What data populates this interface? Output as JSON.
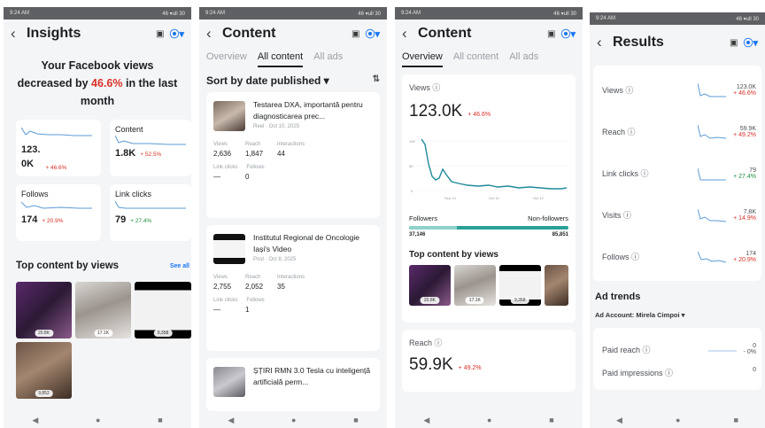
{
  "status": {
    "time": "9:24 AM",
    "icons": "46 ▾ull 30"
  },
  "phone1": {
    "title": "Insights",
    "headline_pre": "Your Facebook views decreased by ",
    "headline_pct": "46.6%",
    "headline_post": " in the last month",
    "tiles": [
      {
        "label": "",
        "value": "123.0K",
        "value_line1": "123.",
        "value_line2": "0K",
        "change": "+ 46.6%"
      },
      {
        "label": "Content",
        "value": "1.8K",
        "change": "+ 52.5%"
      },
      {
        "label": "Follows",
        "value": "174",
        "change": "+ 20.9%"
      },
      {
        "label": "Link clicks",
        "value": "79",
        "change": "+ 27.4%"
      }
    ],
    "top_content_label": "Top content by views",
    "see_all": "See all",
    "thumbs": [
      "20.8K",
      "17.1K",
      "9,358",
      "9,852"
    ]
  },
  "phone2": {
    "title": "Content",
    "tabs": [
      "Overview",
      "All content",
      "All ads"
    ],
    "sort_label": "Sort by date published ▾",
    "sort_icon": "⇅",
    "posts": [
      {
        "title": "Testarea DXA, importantă pentru diagnosticarea prec...",
        "meta": "Reel · Oct 10, 2025",
        "stat_labels": [
          "Views",
          "Reach",
          "Interactions"
        ],
        "stat_values": [
          "2,636",
          "1,847",
          "44"
        ],
        "sub_labels": [
          "Link clicks",
          "Follows"
        ],
        "sub_values": [
          "—",
          "0"
        ]
      },
      {
        "title": "Institutul Regional de Oncologie Iași's Video",
        "meta": "Post · Oct 8, 2025",
        "stat_labels": [
          "Views",
          "Reach",
          "Interactions"
        ],
        "stat_values": [
          "2,755",
          "2,052",
          "35"
        ],
        "sub_labels": [
          "Link clicks",
          "Follows"
        ],
        "sub_values": [
          "—",
          "1"
        ]
      },
      {
        "title": "ȘȚIRI RMN 3.0 Tesla cu inteligență artificială perm...",
        "meta": "",
        "stat_labels": [],
        "stat_values": [],
        "sub_labels": [],
        "sub_values": []
      }
    ]
  },
  "phone3": {
    "title": "Content",
    "tabs": [
      "Overview",
      "All content",
      "All ads"
    ],
    "views_label": "Views ⓘ",
    "views_value": "123.0K",
    "views_change": "+ 46.6%",
    "chart_y_ticks": [
      "10K",
      "5K",
      "0"
    ],
    "chart_x_ticks": [
      "Sep 13",
      "Oct 10",
      "Oct 12"
    ],
    "followers_label": "Followers",
    "nonfollowers_label": "Non-followers",
    "followers_value": "37,146",
    "nonfollowers_value": "85,851",
    "followers_share": 0.302,
    "top_content_label": "Top content by views",
    "thumbs": [
      "20.8K",
      "17.1K",
      "9,358",
      ""
    ],
    "reach_label": "Reach ⓘ",
    "reach_value": "59.9K",
    "reach_change": "+ 49.2%"
  },
  "phone4": {
    "title": "Results",
    "rows": [
      {
        "label": "Views ⓘ",
        "value": "123.0K",
        "change": "+ 46.6%",
        "dir": "red"
      },
      {
        "label": "Reach ⓘ",
        "value": "59.9K",
        "change": "+ 49.2%",
        "dir": "red"
      },
      {
        "label": "Link clicks ⓘ",
        "value": "79",
        "change": "+ 27.4%",
        "dir": "green"
      },
      {
        "label": "Visits ⓘ",
        "value": "7.8K",
        "change": "+ 14.9%",
        "dir": "red"
      },
      {
        "label": "Follows ⓘ",
        "value": "174",
        "change": "+ 20.9%",
        "dir": "red"
      }
    ],
    "ad_trends_label": "Ad trends",
    "ad_account_label": "Ad Account: Mirela Cimpoi ▾",
    "paid_rows": [
      {
        "label": "Paid reach ⓘ",
        "value": "0",
        "change": "- 0%"
      },
      {
        "label": "Paid impressions ⓘ",
        "value": "0",
        "change": ""
      }
    ]
  },
  "nav": {
    "back": "◀",
    "home": "●",
    "recents": "■"
  },
  "colors": {
    "accent_blue": "#1877f2",
    "decrease_red": "#d93025",
    "increase_green": "#1e8e3e",
    "teal": "#2aa198"
  }
}
